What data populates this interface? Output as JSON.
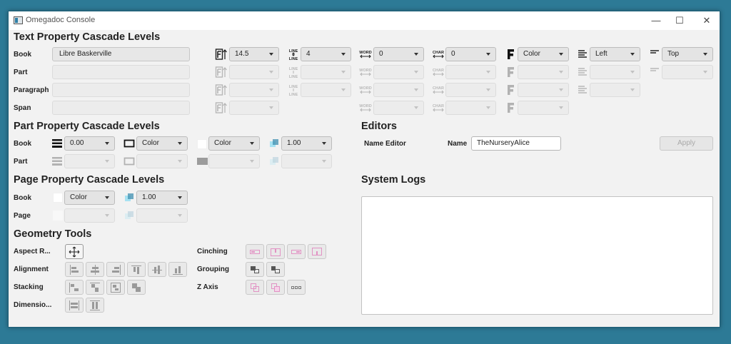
{
  "window": {
    "title": "Omegadoc Console",
    "minimize": "—",
    "maximize": "☐",
    "close": "✕"
  },
  "text_cascade": {
    "title": "Text Property Cascade Levels",
    "rows": [
      {
        "label": "Book",
        "font": "Libre Baskerville",
        "size": "14.5",
        "line": "4",
        "word": "0",
        "char": "0",
        "fill": "Color",
        "align": "Left",
        "valign": "Top"
      },
      {
        "label": "Part",
        "font": "",
        "size": "",
        "line": "",
        "word": "",
        "char": "",
        "fill": "",
        "align": "",
        "valign": ""
      },
      {
        "label": "Paragraph",
        "font": "",
        "size": "",
        "line": "",
        "word": "",
        "char": "",
        "fill": "",
        "align": ""
      },
      {
        "label": "Span",
        "font": "",
        "size": "",
        "word": "",
        "char": "",
        "fill": ""
      }
    ]
  },
  "part_cascade": {
    "title": "Part Property Cascade Levels",
    "rows": [
      {
        "label": "Book",
        "stroke_width": "0.00",
        "stroke": "Color",
        "fill": "Color",
        "opacity": "1.00"
      },
      {
        "label": "Part",
        "stroke_width": "",
        "stroke": "",
        "fill": "",
        "opacity": ""
      }
    ]
  },
  "page_cascade": {
    "title": "Page Property Cascade Levels",
    "rows": [
      {
        "label": "Book",
        "fill": "Color",
        "opacity": "1.00"
      },
      {
        "label": "Page",
        "fill": "",
        "opacity": ""
      }
    ]
  },
  "geometry": {
    "title": "Geometry Tools",
    "aspect_label": "Aspect R...",
    "alignment_label": "Alignment",
    "stacking_label": "Stacking",
    "dimension_label": "Dimensio...",
    "cinching_label": "Cinching",
    "grouping_label": "Grouping",
    "zaxis_label": "Z Axis"
  },
  "editors": {
    "title": "Editors",
    "editor_label": "Name Editor",
    "name_label": "Name",
    "name_value": "TheNurseryAlice",
    "apply": "Apply"
  },
  "logs": {
    "title": "System Logs"
  },
  "icons": {
    "size": "font-size-icon",
    "line": "line-spacing-icon",
    "word": "word-spacing-icon",
    "char": "char-spacing-icon",
    "fill": "text-fill-icon",
    "align": "text-align-icon",
    "valign": "vertical-align-icon"
  },
  "icon_text": {
    "line": "LINE",
    "word": "WORD",
    "char": "CHAR"
  },
  "colors": {
    "background": "#2d7a96",
    "window": "#f2f2f2",
    "accent_magenta": "#e292c4",
    "swatch_cyan": "#5cc8e6"
  }
}
